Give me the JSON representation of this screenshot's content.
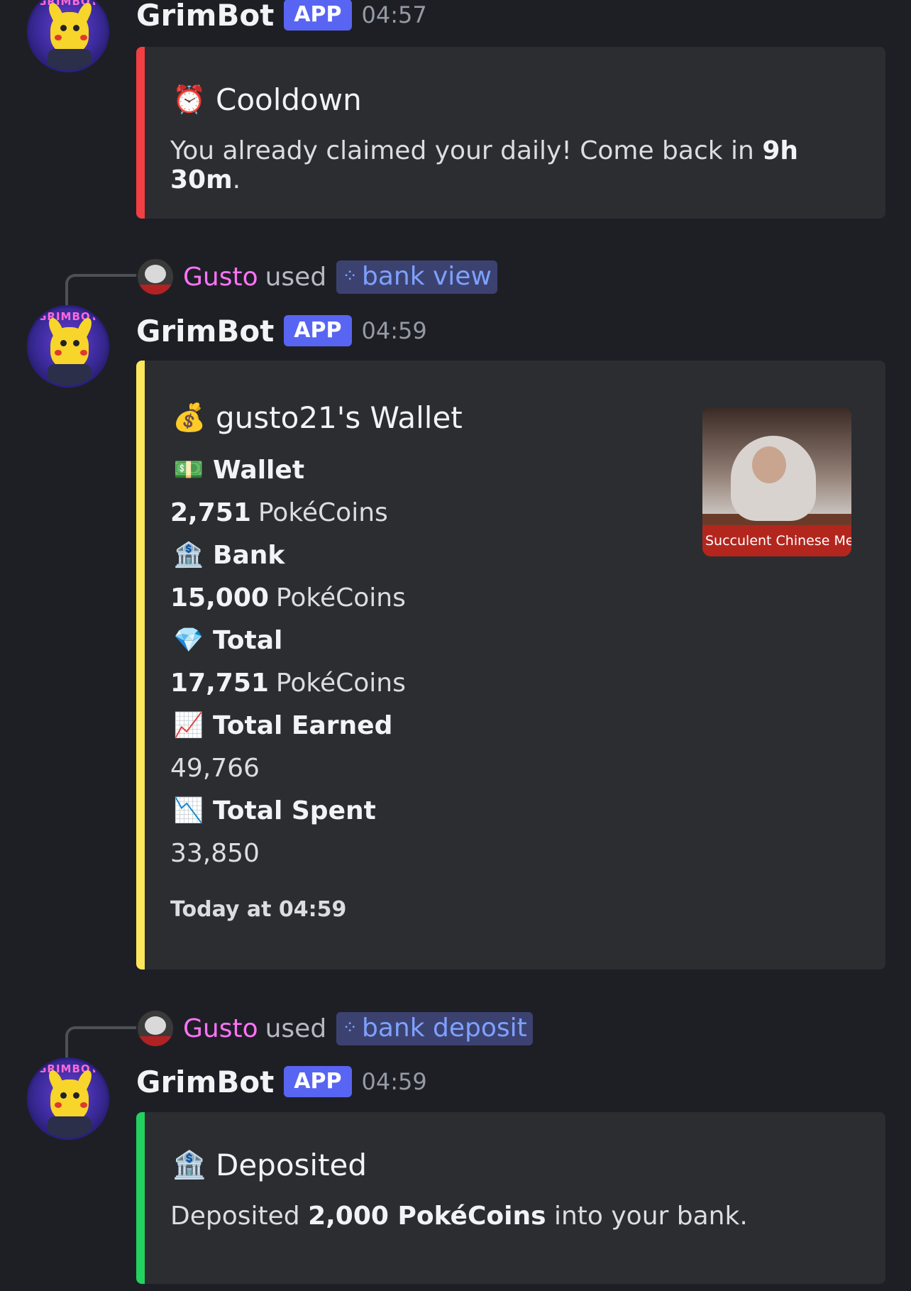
{
  "messages": [
    {
      "bot_name": "GrimBot",
      "badge": "APP",
      "time": "04:57",
      "embed": {
        "color": "#f23f43",
        "icon": "alarm-clock",
        "title": "Cooldown",
        "desc_prefix": "You already claimed your daily! Come back in ",
        "desc_bold": "9h 30m",
        "desc_suffix": "."
      }
    },
    {
      "invoker": {
        "name": "Gusto",
        "used": "used",
        "command": "bank view"
      },
      "bot_name": "GrimBot",
      "badge": "APP",
      "time": "04:59",
      "embed": {
        "color": "#fee75c",
        "icon": "money-bag",
        "title": "gusto21's Wallet",
        "fields": [
          {
            "icon": "dollar-banknote",
            "name": "Wallet",
            "value_bold": "2,751",
            "value_unit": "PokéCoins"
          },
          {
            "icon": "bank-building",
            "name": "Bank",
            "value_bold": "15,000",
            "value_unit": "PokéCoins"
          },
          {
            "icon": "gem",
            "name": "Total",
            "value_bold": "17,751",
            "value_unit": "PokéCoins"
          },
          {
            "icon": "chart-increasing",
            "name": "Total Earned",
            "value_bold": "",
            "value_unit": "49,766"
          },
          {
            "icon": "chart-decreasing",
            "name": "Total Spent",
            "value_bold": "",
            "value_unit": "33,850"
          }
        ],
        "thumbnail_caption": "Succulent Chinese Mea",
        "footer": "Today at 04:59"
      }
    },
    {
      "invoker": {
        "name": "Gusto",
        "used": "used",
        "command": "bank deposit"
      },
      "bot_name": "GrimBot",
      "badge": "APP",
      "time": "04:59",
      "embed": {
        "color": "#23d160",
        "icon": "bank-building",
        "title": "Deposited",
        "desc_prefix": "Deposited ",
        "desc_bold": "2,000 PokéCoins",
        "desc_suffix": " into your bank."
      }
    }
  ]
}
